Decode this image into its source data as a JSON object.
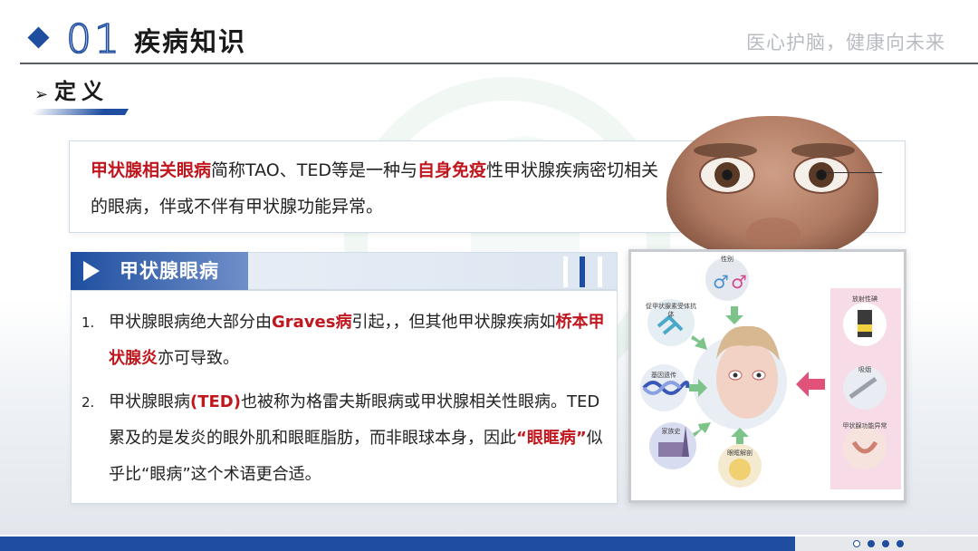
{
  "header": {
    "number": "01",
    "title": "疾病知识",
    "slogan": "医心护脑，健康向未来"
  },
  "subheading": {
    "arrow": "➢",
    "title": "定义"
  },
  "definition": {
    "term": "甲状腺相关眼病",
    "part1": "简称TAO、TED等是一种与",
    "term2": "自身免疫",
    "part2": "性甲状腺疾病密切相关的眼病，伴或不伴有甲状腺功能异常。"
  },
  "section": {
    "title": "甲状腺眼病",
    "items": [
      {
        "number": "1.",
        "t1": "甲状腺眼病绝大部分由",
        "h1": "Graves病",
        "t2": "引起，，但其他甲状腺疾病如",
        "h2": "桥本甲状腺炎",
        "t3": "亦可导致。"
      },
      {
        "number": "2.",
        "t1": "甲状腺眼病",
        "h1": "(TED)",
        "t2": "也被称为格雷夫斯眼病或甲状腺相关性眼病。TED累及的是发炎的眼外肌和眼眶脂肪，而非眼球本身，因此",
        "h2": "“眼眶病”",
        "t3": "似乎比“眼病”这个术语更合适。"
      }
    ]
  },
  "diagram": {
    "labels": {
      "gender": "性别",
      "antibody": "促甲状腺素受体抗体",
      "genetic": "基因遗传",
      "family": "家族史",
      "orbit": "眼眶解剖",
      "radiation": "放射性碘",
      "smoking": "吸烟",
      "thyroid": "甲状腺功能异常"
    }
  },
  "colors": {
    "brand_blue": "#1f4ea0",
    "highlight_red": "#c0161e",
    "arrow_green": "#7cc48a",
    "arrow_pink": "#e0527a"
  }
}
